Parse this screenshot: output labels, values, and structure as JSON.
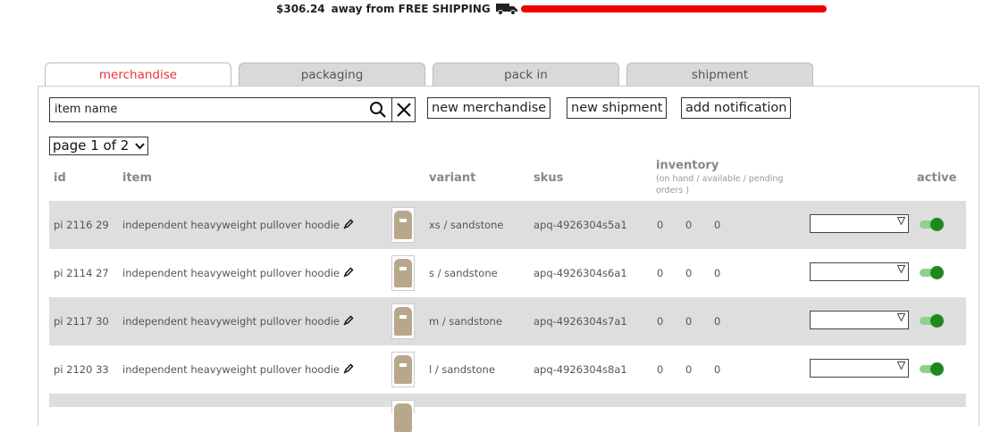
{
  "shipping": {
    "amount": "$306.24",
    "text": "away from FREE SHIPPING",
    "progress": 1.0,
    "bar_color": "#ee0000"
  },
  "tabs": [
    {
      "label": "merchandise",
      "active": true
    },
    {
      "label": "packaging",
      "active": false
    },
    {
      "label": "pack in",
      "active": false
    },
    {
      "label": "shipment",
      "active": false
    }
  ],
  "search": {
    "placeholder": "item name"
  },
  "buttons": {
    "new_merchandise": "new merchandise",
    "new_shipment": "new shipment",
    "add_notification": "add notification"
  },
  "pager": {
    "label": "page 1 of 2"
  },
  "table": {
    "headers": {
      "id": "id",
      "item": "item",
      "variant": "variant",
      "skus": "skus",
      "inventory": "inventory",
      "inventory_sub": "(on hand / available / pending orders )",
      "active": "active"
    },
    "rows": [
      {
        "id": "pi 2116 29",
        "item": "independent heavyweight pullover hoodie",
        "variant": "xs / sandstone",
        "sku": "apq-4926304s5a1",
        "on_hand": "0",
        "available": "0",
        "pending": "0",
        "active": true
      },
      {
        "id": "pi 2114 27",
        "item": "independent heavyweight pullover hoodie",
        "variant": "s / sandstone",
        "sku": "apq-4926304s6a1",
        "on_hand": "0",
        "available": "0",
        "pending": "0",
        "active": true
      },
      {
        "id": "pi 2117 30",
        "item": "independent heavyweight pullover hoodie",
        "variant": "m / sandstone",
        "sku": "apq-4926304s7a1",
        "on_hand": "0",
        "available": "0",
        "pending": "0",
        "active": true
      },
      {
        "id": "pi 2120 33",
        "item": "independent heavyweight pullover hoodie",
        "variant": "l / sandstone",
        "sku": "apq-4926304s8a1",
        "on_hand": "0",
        "available": "0",
        "pending": "0",
        "active": true
      }
    ]
  },
  "icons": {
    "truck": "truck-icon",
    "search": "search-icon",
    "clear": "close-icon",
    "edit": "pencil-icon",
    "dropdown": "chevron-down-icon"
  }
}
